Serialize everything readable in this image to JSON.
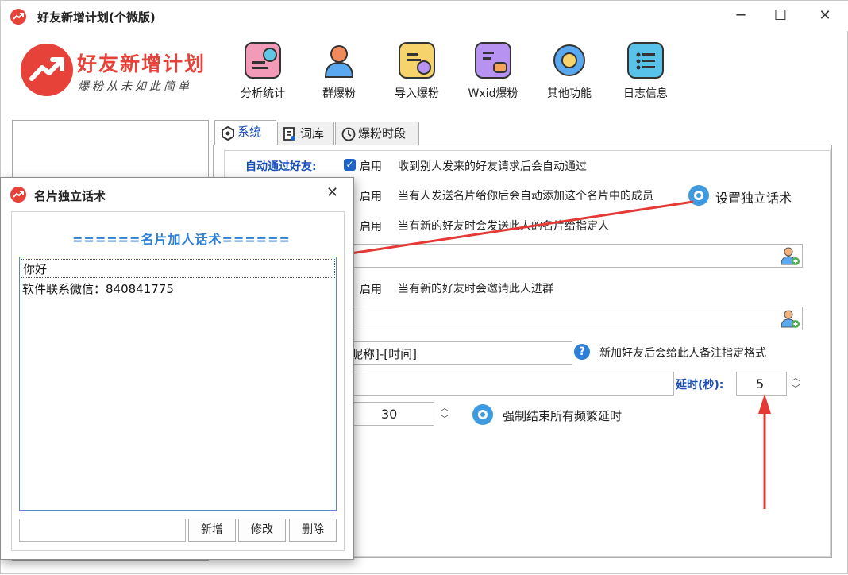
{
  "window": {
    "title": "好友新增计划(个微版)",
    "controls": [
      "─",
      "☐",
      "✕"
    ]
  },
  "brand": {
    "name": "好友新增计划",
    "slogan": "爆粉从未如此简单",
    "color": "#e6423a"
  },
  "toolbar": {
    "items": [
      {
        "label": "分析统计",
        "icon": "chart-icon",
        "color": "#f29bb9"
      },
      {
        "label": "群爆粉",
        "icon": "user-icon",
        "color": "#f08a5d"
      },
      {
        "label": "导入爆粉",
        "icon": "import-icon",
        "color": "#f6d46b"
      },
      {
        "label": "Wxid爆粉",
        "icon": "chat-icon",
        "color": "#b892f0"
      },
      {
        "label": "其他功能",
        "icon": "gear-icon",
        "color": "#5aa9f0"
      },
      {
        "label": "日志信息",
        "icon": "log-icon",
        "color": "#58c2e8"
      }
    ]
  },
  "tabs": [
    {
      "label": "系统",
      "icon": "hexagon-icon",
      "active": true
    },
    {
      "label": "词库",
      "icon": "document-icon",
      "active": false
    },
    {
      "label": "爆粉时段",
      "icon": "clock-icon",
      "active": false
    }
  ],
  "settings": {
    "auto_accept_label": "自动通过好友:",
    "enable_label": "启用",
    "auto_accept_desc": "收到别人发来的好友请求后会自动通过",
    "card_desc": "当有人发送名片给你后会自动添加这个名片中的成员",
    "card_script_btn": "设置独立话术",
    "send_card_desc": "当有新的好友时会发送此人的名片给指定人",
    "invite_desc": "当有新的好友时会邀请此人进群",
    "remark_value": "昵称]-[时间]",
    "remark_desc": "新加好友后会给此人备注指定格式",
    "delay_label": "延时(秒):",
    "delay_value": "5",
    "freq_value": "30",
    "force_end_label": "强制结束所有频繁延时"
  },
  "dialog": {
    "title": "名片独立话术",
    "close": "✕",
    "header": "======名片加人话术======",
    "items": [
      "你好",
      "软件联系微信：840841775"
    ],
    "input_value": "",
    "buttons": {
      "add": "新增",
      "edit": "修改",
      "delete": "删除"
    }
  },
  "colors": {
    "accent": "#1e64c8",
    "arrow": "#e53935",
    "link_text": "#1a4fb8"
  }
}
